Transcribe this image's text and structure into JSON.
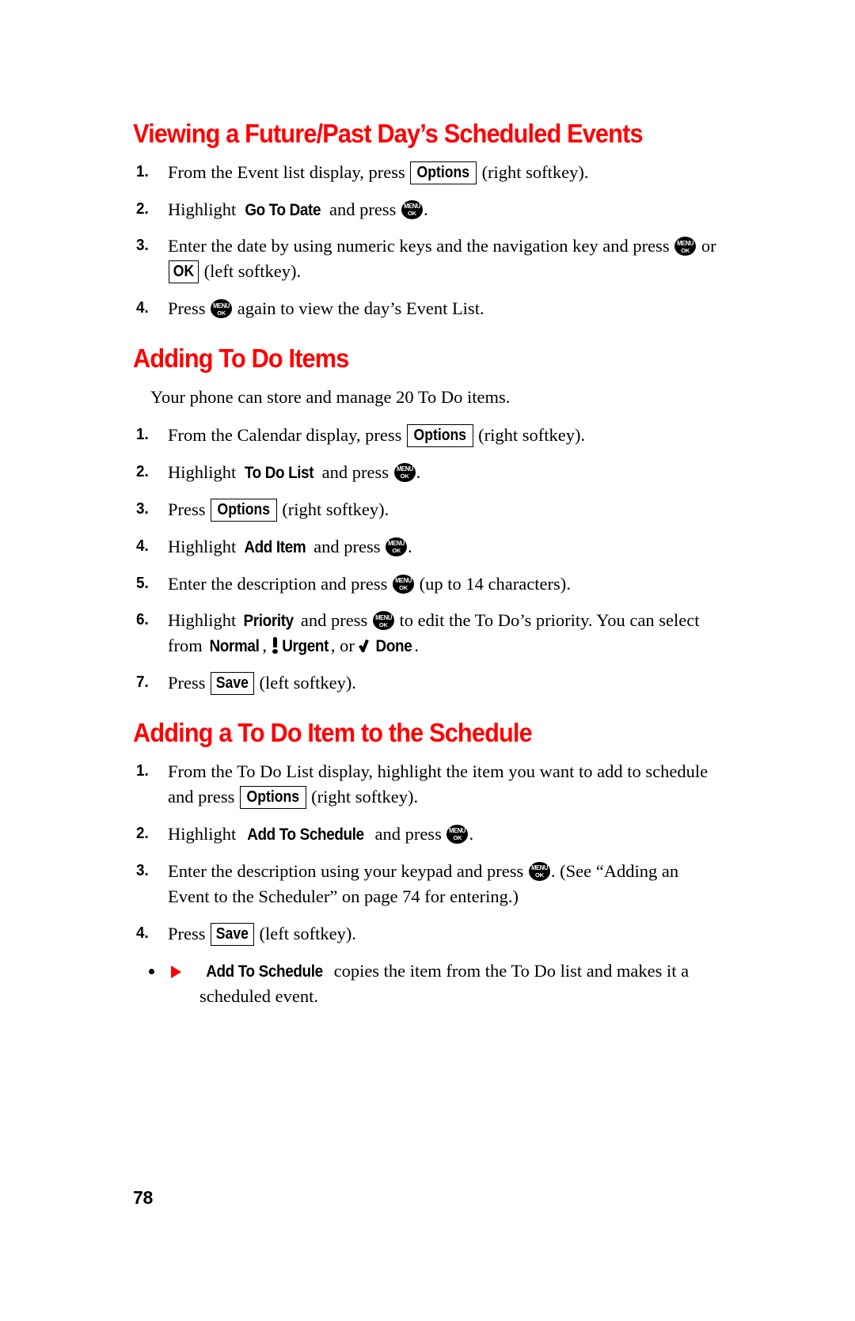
{
  "page": {
    "number": "78",
    "heading_color": "#FF0000",
    "bullet_color": "#FF0000",
    "text_color": "#000000",
    "background": "#FFFFFF"
  },
  "keys": {
    "menu_ok_top": "MENU",
    "menu_ok_bottom": "OK",
    "options": "Options",
    "ok": "OK",
    "save": "Save"
  },
  "sections": [
    {
      "id": "viewing-future-past-day",
      "heading": "Viewing a Future/Past Day’s Scheduled Events",
      "steps": [
        {
          "num": "1.",
          "parts": [
            {
              "type": "text",
              "value": "From the Event list display, press "
            },
            {
              "type": "softkey",
              "value": "Options"
            },
            {
              "type": "text",
              "value": " (right softkey)."
            }
          ]
        },
        {
          "num": "2.",
          "parts": [
            {
              "type": "text",
              "value": "Highlight "
            },
            {
              "type": "ui",
              "value": "Go To Date"
            },
            {
              "type": "text",
              "value": " and press "
            },
            {
              "type": "menukey",
              "value": "MENU OK"
            },
            {
              "type": "text",
              "value": "."
            }
          ]
        },
        {
          "num": "3.",
          "parts": [
            {
              "type": "text",
              "value": "Enter the date by using numeric keys and the navigation key and press "
            },
            {
              "type": "menukey",
              "value": "MENU OK"
            },
            {
              "type": "text",
              "value": " or "
            },
            {
              "type": "softkey",
              "value": "OK"
            },
            {
              "type": "text",
              "value": " (left softkey)."
            }
          ]
        },
        {
          "num": "4.",
          "parts": [
            {
              "type": "text",
              "value": "Press "
            },
            {
              "type": "menukey",
              "value": "MENU OK"
            },
            {
              "type": "text",
              "value": " again to view the day’s Event List."
            }
          ]
        }
      ]
    },
    {
      "id": "adding-to-do-items",
      "heading": "Adding To Do Items",
      "intro": "Your phone can store and manage 20 To Do items.",
      "steps": [
        {
          "num": "1.",
          "parts": [
            {
              "type": "text",
              "value": "From the Calendar display, press "
            },
            {
              "type": "softkey",
              "value": "Options"
            },
            {
              "type": "text",
              "value": " (right softkey)."
            }
          ]
        },
        {
          "num": "2.",
          "parts": [
            {
              "type": "text",
              "value": "Highlight "
            },
            {
              "type": "ui",
              "value": "To Do List"
            },
            {
              "type": "text",
              "value": " and press "
            },
            {
              "type": "menukey",
              "value": "MENU OK"
            },
            {
              "type": "text",
              "value": "."
            }
          ]
        },
        {
          "num": "3.",
          "parts": [
            {
              "type": "text",
              "value": "Press "
            },
            {
              "type": "softkey",
              "value": "Options"
            },
            {
              "type": "text",
              "value": " (right softkey)."
            }
          ]
        },
        {
          "num": "4.",
          "parts": [
            {
              "type": "text",
              "value": "Highlight "
            },
            {
              "type": "ui",
              "value": "Add Item"
            },
            {
              "type": "text",
              "value": " and press "
            },
            {
              "type": "menukey",
              "value": "MENU OK"
            },
            {
              "type": "text",
              "value": "."
            }
          ]
        },
        {
          "num": "5.",
          "parts": [
            {
              "type": "text",
              "value": "Enter the description and press "
            },
            {
              "type": "menukey",
              "value": "MENU OK"
            },
            {
              "type": "text",
              "value": " (up to 14 characters)."
            }
          ]
        },
        {
          "num": "6.",
          "parts": [
            {
              "type": "text",
              "value": "Highlight "
            },
            {
              "type": "ui",
              "value": "Priority"
            },
            {
              "type": "text",
              "value": " and press "
            },
            {
              "type": "menukey",
              "value": "MENU OK"
            },
            {
              "type": "text",
              "value": " to edit the To Do’s priority. You can select from "
            },
            {
              "type": "ui",
              "value": "Normal"
            },
            {
              "type": "text",
              "value": ", "
            },
            {
              "type": "urgent-icon",
              "value": "urgent-icon"
            },
            {
              "type": "ui",
              "value": "Urgent"
            },
            {
              "type": "text",
              "value": ", or "
            },
            {
              "type": "done-icon",
              "value": "done-icon"
            },
            {
              "type": "ui",
              "value": "Done"
            },
            {
              "type": "text",
              "value": "."
            }
          ]
        },
        {
          "num": "7.",
          "parts": [
            {
              "type": "text",
              "value": "Press "
            },
            {
              "type": "softkey",
              "value": "Save"
            },
            {
              "type": "text",
              "value": " (left softkey)."
            }
          ]
        }
      ]
    },
    {
      "id": "adding-a-to-do-item-to-the-schedule",
      "heading": "Adding a To Do Item to the Schedule",
      "steps": [
        {
          "num": "1.",
          "parts": [
            {
              "type": "text",
              "value": "From the To Do List display, highlight the item you want to add to schedule and press "
            },
            {
              "type": "softkey",
              "value": "Options"
            },
            {
              "type": "text",
              "value": " (right softkey)."
            }
          ]
        },
        {
          "num": "2.",
          "parts": [
            {
              "type": "text",
              "value": "Highlight "
            },
            {
              "type": "ui",
              "value": "Add To Schedule"
            },
            {
              "type": "text",
              "value": " and press "
            },
            {
              "type": "menukey",
              "value": "MENU OK"
            },
            {
              "type": "text",
              "value": "."
            }
          ]
        },
        {
          "num": "3.",
          "parts": [
            {
              "type": "text",
              "value": "Enter the description using your keypad and press "
            },
            {
              "type": "menukey",
              "value": "MENU OK"
            },
            {
              "type": "text",
              "value": ". (See “Adding an Event to the Scheduler” on page 74 for entering.)"
            }
          ]
        },
        {
          "num": "4.",
          "parts": [
            {
              "type": "text",
              "value": "Press "
            },
            {
              "type": "softkey",
              "value": "Save"
            },
            {
              "type": "text",
              "value": " (left softkey)."
            }
          ]
        }
      ],
      "note": {
        "parts": [
          {
            "type": "ui",
            "value": "Add To Schedule"
          },
          {
            "type": "text",
            "value": " copies the item from the To Do list and makes it a scheduled event."
          }
        ]
      }
    }
  ]
}
